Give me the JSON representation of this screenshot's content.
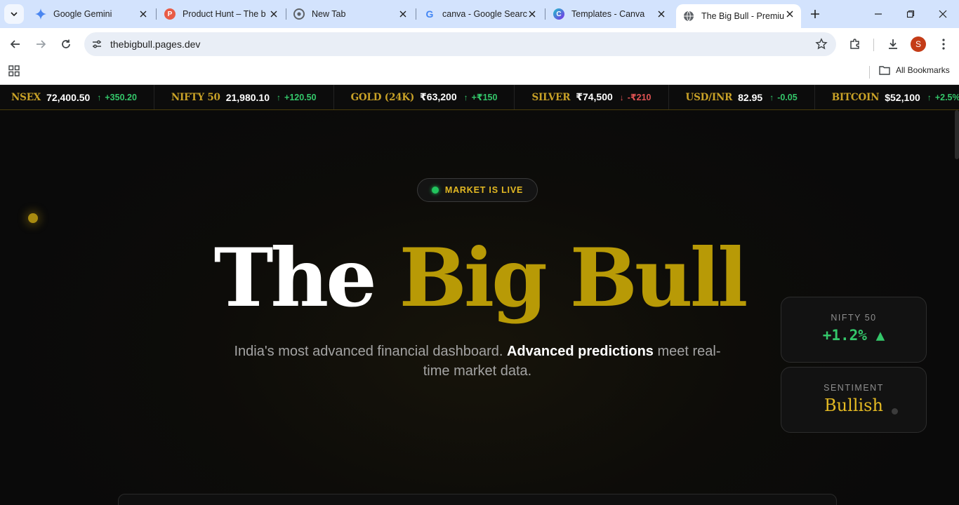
{
  "browser": {
    "tabs": [
      {
        "title": "Google Gemini",
        "icon": "gemini-icon"
      },
      {
        "title": "Product Hunt – The b",
        "icon": "product-hunt-icon"
      },
      {
        "title": "New Tab",
        "icon": "chrome-icon"
      },
      {
        "title": "canva - Google Searc",
        "icon": "google-icon"
      },
      {
        "title": "Templates - Canva",
        "icon": "canva-icon"
      },
      {
        "title": "The Big Bull - Premiu",
        "icon": "globe-icon",
        "active": true
      }
    ],
    "url": "thebigbull.pages.dev",
    "avatar_letter": "S",
    "bookmarks_label": "All Bookmarks"
  },
  "ticker": [
    {
      "name": "NSEX",
      "price": "72,400.50",
      "change": "+350.20",
      "dir": "up"
    },
    {
      "name": "NIFTY 50",
      "price": "21,980.10",
      "change": "+120.50",
      "dir": "up"
    },
    {
      "name": "GOLD (24K)",
      "price": "₹63,200",
      "change": "+₹150",
      "dir": "up"
    },
    {
      "name": "SILVER",
      "price": "₹74,500",
      "change": "-₹210",
      "dir": "down"
    },
    {
      "name": "USD/INR",
      "price": "82.95",
      "change": "-0.05",
      "dir": "up"
    },
    {
      "name": "BITCOIN",
      "price": "$52,100",
      "change": "+2.5%",
      "dir": "up"
    }
  ],
  "hero": {
    "status": "MARKET IS LIVE",
    "title_part1": "The",
    "title_part2": "Big Bull",
    "subtitle_start": "India's most advanced financial dashboard.",
    "subtitle_bold": "Advanced predictions",
    "subtitle_end": "meet real-time market data."
  },
  "cards": {
    "nifty_label": "NIFTY 50",
    "nifty_value": "+1.2% ▲",
    "sentiment_label": "SENTIMENT",
    "sentiment_value": "Bullish"
  },
  "colors": {
    "gold": "#b89a06",
    "accent_gold": "#e3b923",
    "up": "#34c76a",
    "down": "#e05353",
    "background": "#0a0a0a"
  }
}
